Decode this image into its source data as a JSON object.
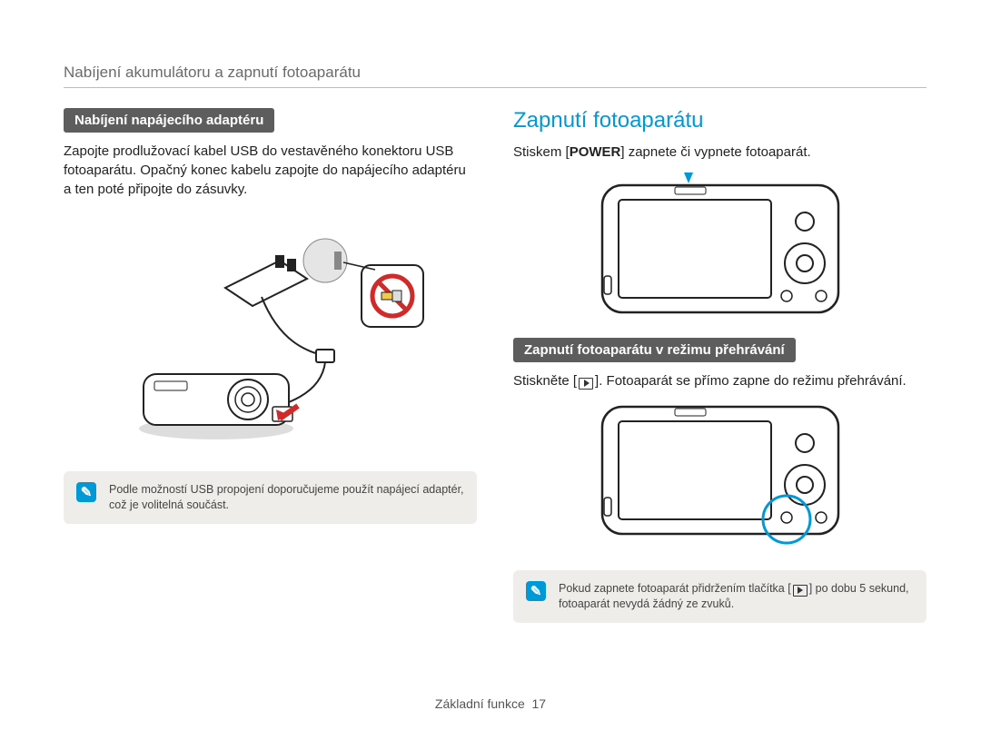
{
  "header": {
    "title": "Nabíjení akumulátoru a zapnutí fotoaparátu"
  },
  "left": {
    "section_title": "Nabíjení napájecího adaptéru",
    "body": "Zapojte prodlužovací kabel USB do vestavěného konektoru USB fotoaparátu. Opačný konec kabelu zapojte do napájecího adaptéru a ten poté připojte do zásuvky.",
    "note": "Podle možností USB propojení doporučujeme použít napájecí adaptér, což je volitelná součást."
  },
  "right": {
    "heading": "Zapnutí fotoaparátu",
    "body1_pre": "Stiskem [",
    "body1_bold": "POWER",
    "body1_post": "] zapnete či vypnete fotoaparát.",
    "section_title2": "Zapnutí fotoaparátu v režimu přehrávání",
    "body2_pre": "Stiskněte [",
    "body2_post": "]. Fotoaparát se přímo zapne do režimu přehrávání.",
    "note_pre": "Pokud zapnete fotoaparát přidržením tlačítka [",
    "note_post": "] po dobu 5 sekund, fotoaparát nevydá žádný ze zvuků."
  },
  "footer": {
    "section": "Základní funkce",
    "page": "17"
  },
  "icons": {
    "note_glyph": "✎"
  }
}
